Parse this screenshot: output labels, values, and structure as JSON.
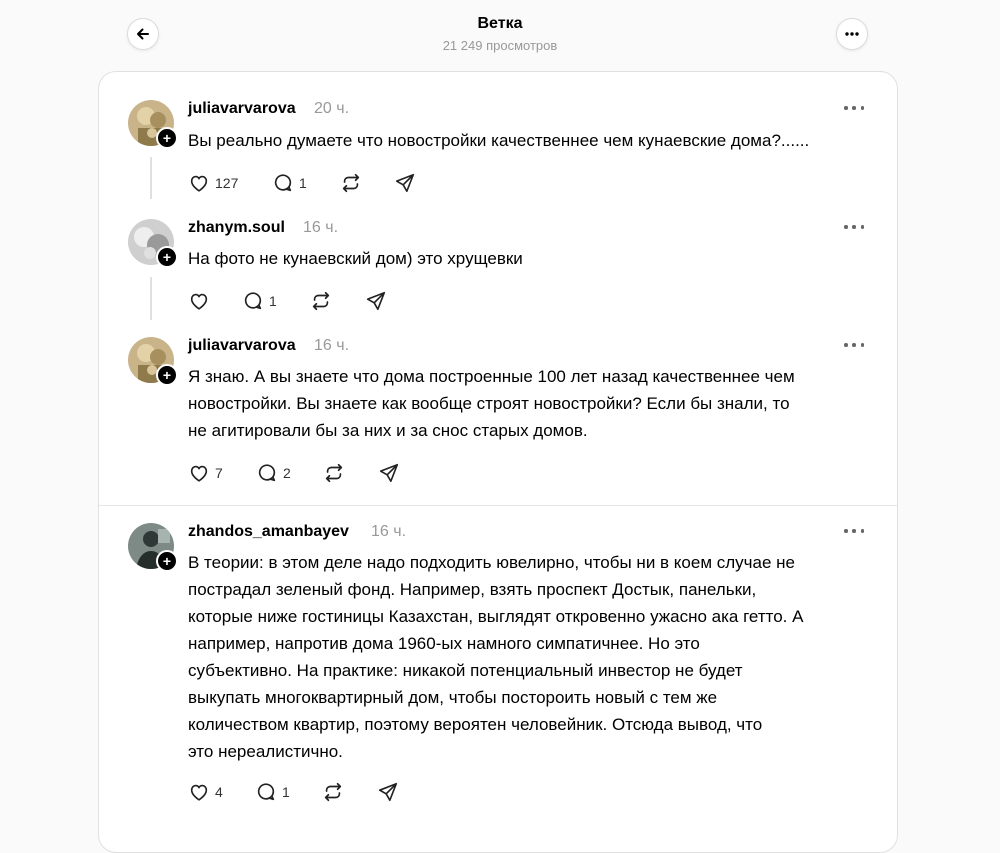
{
  "header": {
    "title": "Ветка",
    "views": "21 249 просмотров",
    "back_icon": "arrow-left-icon",
    "more_icon": "more-horizontal-icon"
  },
  "posts": [
    {
      "username": "juliavarvarova",
      "time": "20 ч.",
      "lines": [
        "Вы реально думаете что новостройки качественнее чем кунаевские дома?......"
      ],
      "likes": "127",
      "replies": "1"
    },
    {
      "username": "zhanym.soul",
      "time": "16 ч.",
      "lines": [
        "На фото не кунаевский дом) это хрущевки"
      ],
      "likes": "",
      "replies": "1"
    },
    {
      "username": "juliavarvarova",
      "time": "16 ч.",
      "lines": [
        "Я знаю. А вы знаете что дома построенные 100 лет назад качественнее чем",
        "новостройки. Вы знаете как вообще строят новостройки? Если бы знали, то",
        "не агитировали бы за них и за снос старых домов."
      ],
      "likes": "7",
      "replies": "2"
    },
    {
      "username": "zhandos_amanbayev",
      "time": "16 ч.",
      "lines": [
        "В теории: в этом деле надо подходить ювелирно, чтобы ни в коем случае не",
        "пострадал зеленый фонд. Например, взять проспект Достык, панельки,",
        "которые ниже гостиницы Казахстан, выглядят откровенно ужасно ака гетто. А",
        "например, напротив дома 1960-ых намного симпатичнее. Но это",
        "субъективно. На практике: никакой потенциальный инвестор не будет",
        "выкупать многоквартирный дом, чтобы постороить новый с тем же",
        "количеством квартир, поэтому вероятен человейник. Отсюда вывод, что",
        "это нереалистично."
      ],
      "likes": "4",
      "replies": "1"
    }
  ],
  "icons": {
    "like": "heart-icon",
    "reply": "comment-icon",
    "repost": "repost-icon",
    "share": "send-icon",
    "follow": "plus-icon"
  },
  "colors": {
    "text": "#000000",
    "muted": "#999999",
    "border": "#e0e0e0",
    "background": "#fafafa",
    "card": "#ffffff"
  }
}
